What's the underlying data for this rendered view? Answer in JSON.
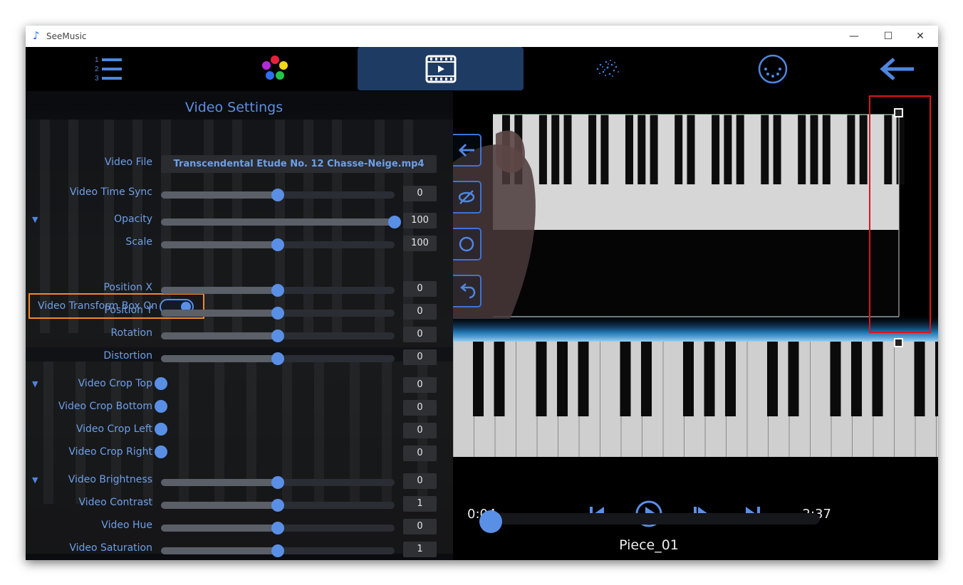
{
  "window": {
    "title": "SeeMusic",
    "minimize": "—",
    "maximize": "☐",
    "close": "✕"
  },
  "toolbar": {
    "tabs": [
      {
        "name": "list",
        "icon": "numbered-list-icon",
        "active": false
      },
      {
        "name": "colors",
        "icon": "color-palette-icon",
        "active": false
      },
      {
        "name": "video",
        "icon": "film-strip-icon",
        "active": true
      },
      {
        "name": "particles",
        "icon": "particles-icon",
        "active": false
      },
      {
        "name": "midi",
        "icon": "midi-port-icon",
        "active": false
      },
      {
        "name": "back",
        "icon": "arrow-left-icon",
        "active": false
      }
    ]
  },
  "video_settings": {
    "title": "Video Settings",
    "video_file_label": "Video File",
    "video_file_value": "Transcendental Etude No. 12 Chasse-Neige.mp4",
    "time_sync": {
      "label": "Video Time Sync",
      "value": "0",
      "level": 0.5
    },
    "opacity": {
      "label": "Opacity",
      "value": "100",
      "level": 1.0
    },
    "scale": {
      "label": "Scale",
      "value": "100",
      "level": 0.5
    },
    "transform_box": {
      "label": "Video Transform Box On",
      "on": true
    },
    "position_x": {
      "label": "Position X",
      "value": "0",
      "level": 0.5
    },
    "position_y": {
      "label": "Position Y",
      "value": "0",
      "level": 0.5
    },
    "rotation": {
      "label": "Rotation",
      "value": "0",
      "level": 0.5
    },
    "distortion": {
      "label": "Distortion",
      "value": "0",
      "level": 0.5
    },
    "crop_top": {
      "label": "Video Crop Top",
      "value": "0"
    },
    "crop_bottom": {
      "label": "Video Crop Bottom",
      "value": "0"
    },
    "crop_left": {
      "label": "Video Crop Left",
      "value": "0"
    },
    "crop_right": {
      "label": "Video Crop Right",
      "value": "0"
    },
    "brightness": {
      "label": "Video Brightness",
      "value": "0",
      "level": 0.5
    },
    "contrast": {
      "label": "Video Contrast",
      "value": "1",
      "level": 0.5
    },
    "hue": {
      "label": "Video Hue",
      "value": "0",
      "level": 0.5
    },
    "saturation": {
      "label": "Video Saturation",
      "value": "1",
      "level": 0.5
    }
  },
  "player": {
    "elapsed": "0:04",
    "remaining": "-2:37",
    "progress": 0.03,
    "piece_name": "Piece_01"
  },
  "colors": {
    "accent": "#5a8fe6",
    "label": "#6e9fe8",
    "active_tab": "#1e3b63",
    "highlight_orange": "#f0892a",
    "highlight_red": "#e0141a"
  }
}
